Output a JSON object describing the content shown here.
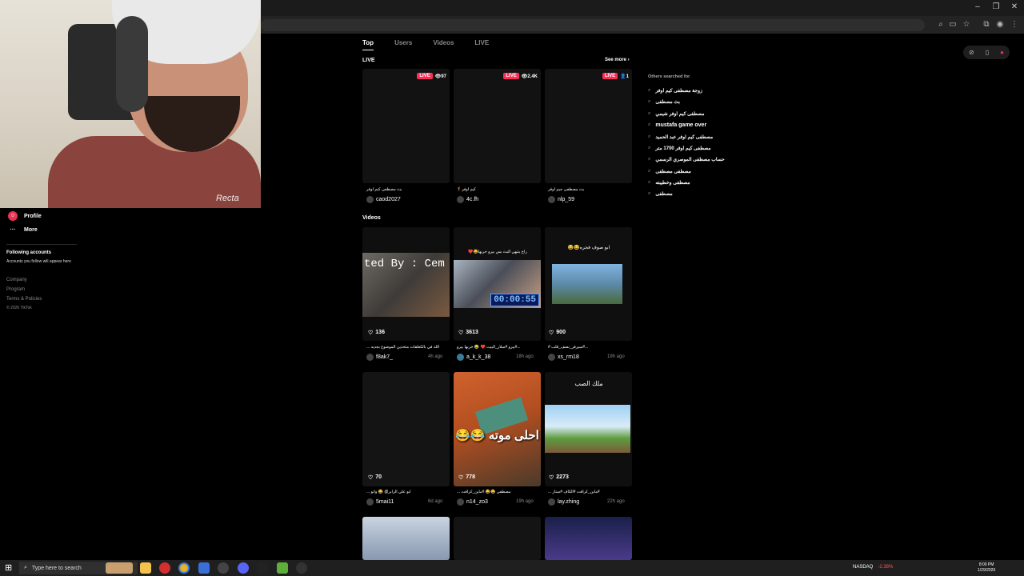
{
  "browser": {
    "window_controls": [
      "–",
      "❐",
      "✕"
    ]
  },
  "nav": {
    "profile": "Profile",
    "more": "More",
    "following_title": "Following accounts",
    "following_sub": "Accounts you follow will appear here",
    "footer": [
      "Company",
      "Program",
      "Terms & Policies",
      "© 2026 TikTok"
    ]
  },
  "tabs": [
    "Top",
    "Users",
    "Videos",
    "LIVE"
  ],
  "live_section": {
    "title": "LIVE",
    "see_more": "See more ›",
    "cards": [
      {
        "badge": "LIVE",
        "viewers": "👁97",
        "caption": "بث مصطفى كيم اوفر",
        "user": "caod2027"
      },
      {
        "badge": "LIVE",
        "viewers": "👁2.4K",
        "caption": "كيم اوفر🏌️",
        "user": "4c.fh"
      },
      {
        "badge": "LIVE",
        "viewers": "👤1",
        "caption": "بث مصطفى جيم اوفر",
        "user": "nlp_59"
      }
    ]
  },
  "videos_section": {
    "title": "Videos",
    "row1": [
      {
        "overlay": "ted By : Cem",
        "likes": "136",
        "caption": "الله في بالكعلقات متخذين الموضوع بجديه ...",
        "user": "f8ak7_",
        "ago": "4h ago"
      },
      {
        "overlay": "راح ينتهي البث بس بيرو خربها😂❤️",
        "timer": "00:00:55",
        "likes": "3613",
        "caption": "...#بيرو #سلار_البيت ❤️ 😂 خربها بيرو",
        "user": "a_k_k_38",
        "ago": "18h ago"
      },
      {
        "overlay": "ابو صوف فجره😂😂",
        "likes": "900",
        "caption": "...#سيرفر_نصف_قلب #",
        "user": "xs_rm18",
        "ago": "19h ago"
      }
    ],
    "row2": [
      {
        "likes": "70",
        "caption": "ابو علي الرابر@ 😂 وانو ...",
        "user": "5mai11",
        "ago": "6d ago"
      },
      {
        "overlay": "احلى موته 😂😂",
        "likes": "778",
        "caption": "مصطفى 😂😂 #ماين_كرافت ...",
        "user": "n14_zo3",
        "ago": "19h ago"
      },
      {
        "overlay": "ملك الصب",
        "likes": "2273",
        "caption": "#ماين_كرافت #الكاف #ستار ...",
        "user": "lay.zhing",
        "ago": "22h ago"
      }
    ]
  },
  "others_searched": {
    "title": "Others searched for",
    "items": [
      "زوجة مصطفى كيم اوفر",
      "بث مصطفى",
      "مصطفى كيم اوفر شيمي",
      "mustafa game over",
      "مصطفى كيم اوفر عبد الحميد",
      "مصطفى كيم اوفر 1700 متر",
      "حساب مصطفى الموصري الرسمي",
      "مصطفى مصطفى",
      "مصطفى وخطيبته",
      "مصطفى"
    ]
  },
  "webcam": {
    "brand": "Recta"
  },
  "taskbar": {
    "search_placeholder": "Type here to search",
    "ticker_name": "NASDAQ",
    "ticker_change": "-2.38%",
    "time": "8:00 PM",
    "date": "1/29/2026"
  },
  "colors": {
    "accent": "#fe2c55",
    "background": "#000000"
  }
}
